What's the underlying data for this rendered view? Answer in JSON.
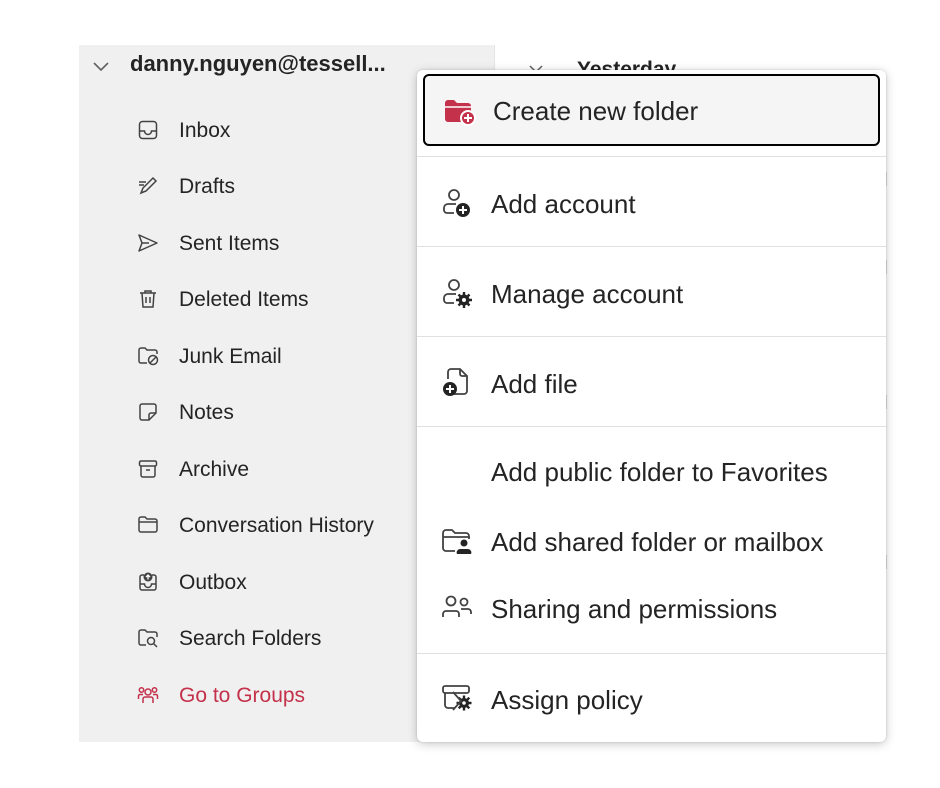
{
  "folder_pane": {
    "account_name": "danny.nguyen@tessell...",
    "folders": [
      {
        "label": "Inbox",
        "icon": "inbox-icon"
      },
      {
        "label": "Drafts",
        "icon": "drafts-icon"
      },
      {
        "label": "Sent Items",
        "icon": "send-icon"
      },
      {
        "label": "Deleted Items",
        "icon": "trash-icon"
      },
      {
        "label": "Junk Email",
        "icon": "junk-folder-icon"
      },
      {
        "label": "Notes",
        "icon": "note-icon"
      },
      {
        "label": "Archive",
        "icon": "archive-icon"
      },
      {
        "label": "Conversation History",
        "icon": "folder-icon"
      },
      {
        "label": "Outbox",
        "icon": "outbox-icon"
      },
      {
        "label": "Search Folders",
        "icon": "search-folder-icon"
      },
      {
        "label": "Go to Groups",
        "icon": "groups-icon"
      }
    ]
  },
  "message_list": {
    "group_header": "Yesterday"
  },
  "context_menu": {
    "items": [
      {
        "label": "Create new folder",
        "icon": "new-folder-icon",
        "selected": true
      },
      {
        "label": "Add account",
        "icon": "add-person-icon"
      },
      {
        "label": "Manage account",
        "icon": "person-settings-icon"
      },
      {
        "label": "Add file",
        "icon": "add-file-icon"
      },
      {
        "label": "Add public folder to Favorites",
        "icon": ""
      },
      {
        "label": "Add shared folder or mailbox",
        "icon": "shared-folder-icon"
      },
      {
        "label": "Sharing and permissions",
        "icon": "people-icon"
      },
      {
        "label": "Assign policy",
        "icon": "policy-icon",
        "has_submenu": true
      }
    ]
  },
  "colors": {
    "accent_red": "#c4314b",
    "pane_bg": "#f0f0f0",
    "menu_bg": "#ffffff"
  }
}
